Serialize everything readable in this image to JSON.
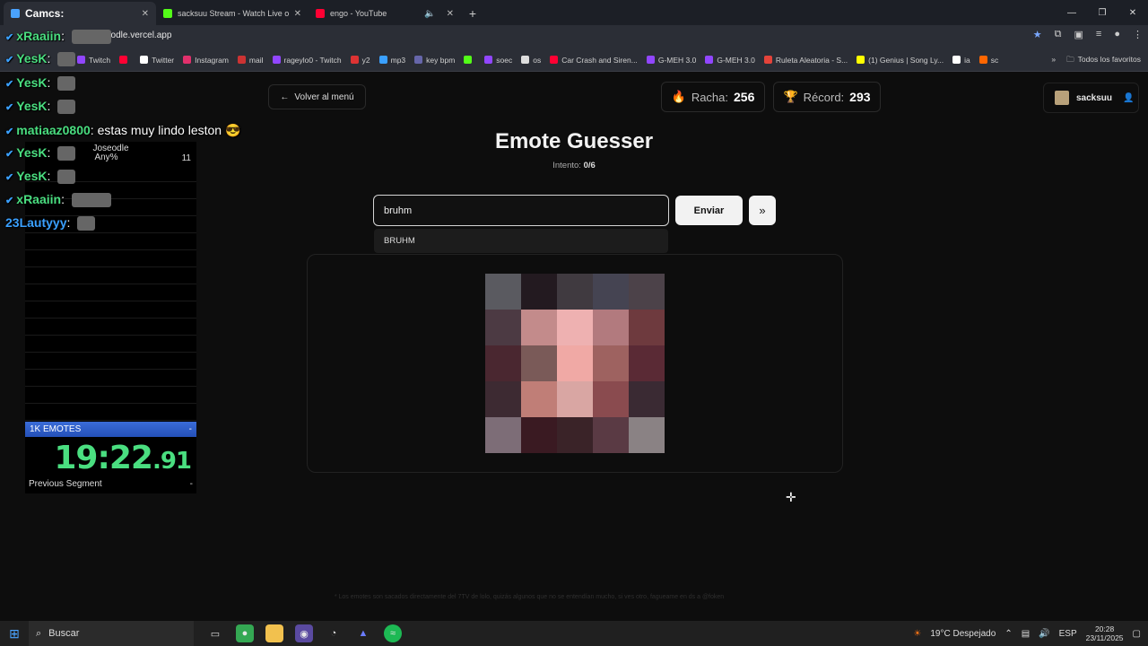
{
  "browser": {
    "tabs": [
      {
        "label": "Camcs:",
        "active": true,
        "color": "#4aa3ff"
      },
      {
        "label": "sacksuu Stream - Watch Live o",
        "active": false,
        "color": "#53fc18"
      },
      {
        "label": "engo - YouTube",
        "active": false,
        "color": "#ff0033"
      }
    ],
    "url": "seodle.vercel.app",
    "bookmarks": [
      {
        "label": "Twitch",
        "color": "#9146ff"
      },
      {
        "label": "",
        "color": "#ff0033"
      },
      {
        "label": "Twitter",
        "color": "#ffffff"
      },
      {
        "label": "Instagram",
        "color": "#e1306c"
      },
      {
        "label": "mail",
        "color": "#c33"
      },
      {
        "label": "rageylo0 - Twitch",
        "color": "#9146ff"
      },
      {
        "label": "y2",
        "color": "#d33"
      },
      {
        "label": "mp3",
        "color": "#3aa0ff"
      },
      {
        "label": "key bpm",
        "color": "#66a"
      },
      {
        "label": "",
        "color": "#53fc18"
      },
      {
        "label": "soec",
        "color": "#9146ff"
      },
      {
        "label": "os",
        "color": "#ddd"
      },
      {
        "label": "Car Crash and Siren...",
        "color": "#ff0033"
      },
      {
        "label": "G-MEH 3.0",
        "color": "#9146ff"
      },
      {
        "label": "G-MEH 3.0",
        "color": "#9146ff"
      },
      {
        "label": "Ruleta Aleatoria - S...",
        "color": "#e4433a"
      },
      {
        "label": "(1) Genius | Song Ly...",
        "color": "#ff0"
      },
      {
        "label": "ia",
        "color": "#fff"
      },
      {
        "label": "sc",
        "color": "#f60"
      }
    ],
    "favorites_label": "Todos los favoritos"
  },
  "overlay": {
    "chat": [
      {
        "user": "xRaaiin",
        "color": "#4ade80",
        "message": "",
        "emote": "wide"
      },
      {
        "user": "YesK",
        "color": "#4ade80",
        "message": "",
        "emote": "small"
      },
      {
        "user": "YesK",
        "color": "#4ade80",
        "message": "",
        "emote": "small"
      },
      {
        "user": "YesK",
        "color": "#4ade80",
        "message": "",
        "emote": "small"
      },
      {
        "user": "matiaaz0800",
        "color": "#4ade80",
        "message": "estas muy lindo leston 😎",
        "emote": "none"
      },
      {
        "user": "YesK",
        "color": "#4ade80",
        "message": "",
        "emote": "small"
      },
      {
        "user": "YesK",
        "color": "#4ade80",
        "message": "",
        "emote": "small"
      },
      {
        "user": "xRaaiin",
        "color": "#4ade80",
        "message": "",
        "emote": "wide"
      },
      {
        "user": "23Lautyyy",
        "color": "#3aa0ff",
        "message": "",
        "emote": "small"
      }
    ],
    "splits": {
      "game": "Joseodle",
      "category": "Any%",
      "attempts": "11",
      "segment": "1K EMOTES",
      "timer_main": "19:22",
      "timer_ms": ".91",
      "previous_label": "Previous Segment",
      "previous_value": "-"
    }
  },
  "page": {
    "back_label": "Volver al menú",
    "streak_label": "Racha:",
    "streak_value": "256",
    "record_label": "Récord:",
    "record_value": "293",
    "username": "sacksuu",
    "title": "Emote Guesser",
    "attempt_label": "Intento:",
    "attempt_value": "0/6",
    "guess_value": "bruhm",
    "send_label": "Enviar",
    "skip_label": "»",
    "suggestion": "BRUHM",
    "footnote": "* Los emotes son sacados directamente del 7TV de lolo, quizás algunos que no se entendían mucho, si ves otro, fagueame en ds a @foken",
    "pixel_colors": [
      "#5a5a60",
      "#231a20",
      "#403a40",
      "#454452",
      "#4c4249",
      "#4c3a43",
      "#c38b8b",
      "#eeb1b1",
      "#b27a7e",
      "#6e3a3e",
      "#4a2730",
      "#7a5a58",
      "#f0a9a5",
      "#9e6260",
      "#5a2a35",
      "#3d2a32",
      "#c07e77",
      "#d9a6a3",
      "#8a4b4f",
      "#3a2a33",
      "#7d6d77",
      "#3a1a22",
      "#3a2328",
      "#5a3a44",
      "#8a8284"
    ]
  },
  "taskbar": {
    "search_label": "Buscar",
    "weather": "19°C Despejado",
    "lang": "ESP",
    "time": "20:28",
    "date": "23/11/2025"
  }
}
